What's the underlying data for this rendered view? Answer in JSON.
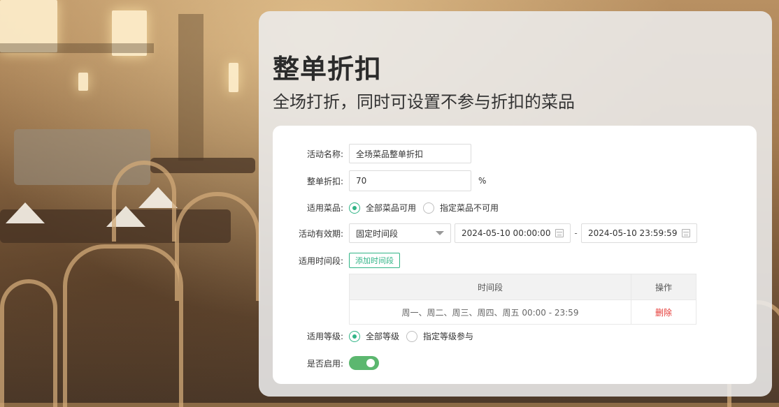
{
  "header": {
    "title": "整单折扣",
    "subtitle": "全场打折，同时可设置不参与折扣的菜品"
  },
  "form": {
    "activity_name": {
      "label": "活动名称:",
      "value": "全场菜品整单折扣"
    },
    "discount": {
      "label": "整单折扣:",
      "value": "70",
      "unit": "%"
    },
    "dishes": {
      "label": "适用菜品:",
      "options": [
        {
          "label": "全部菜品可用",
          "selected": true
        },
        {
          "label": "指定菜品不可用",
          "selected": false
        }
      ]
    },
    "validity": {
      "label": "活动有效期:",
      "type_selected": "固定时间段",
      "start": "2024-05-10 00:00:00",
      "separator": "-",
      "end": "2024-05-10 23:59:59"
    },
    "time_slots": {
      "label": "适用时间段:",
      "add_button": "添加时间段",
      "table": {
        "columns": [
          "时间段",
          "操作"
        ],
        "rows": [
          {
            "time": "周一、周二、周三、周四、周五 00:00 - 23:59",
            "action": "删除"
          }
        ]
      }
    },
    "levels": {
      "label": "适用等级:",
      "options": [
        {
          "label": "全部等级",
          "selected": true
        },
        {
          "label": "指定等级参与",
          "selected": false
        }
      ]
    },
    "enabled": {
      "label": "是否启用:",
      "value": true
    }
  },
  "colors": {
    "accent": "#31b486",
    "toggle_on": "#5cb76f",
    "danger": "#e53935"
  },
  "icons": {
    "dropdown": "chevron-down-icon",
    "date": "calendar-icon"
  }
}
